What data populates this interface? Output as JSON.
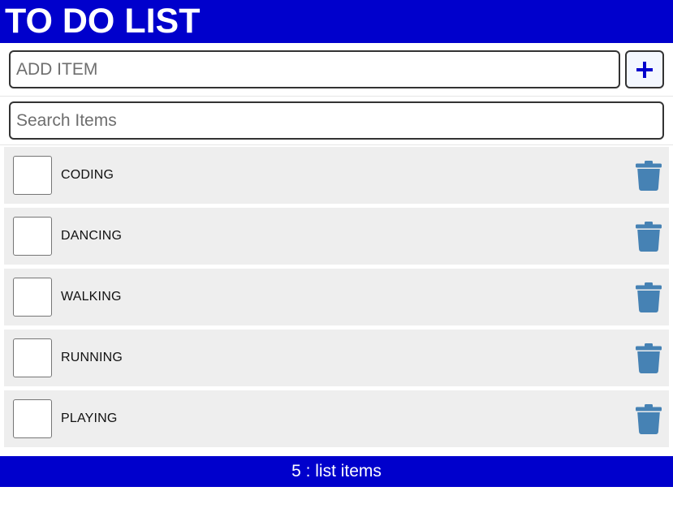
{
  "header": {
    "title": "TO DO LIST"
  },
  "add_item": {
    "placeholder": "ADD ITEM",
    "value": "",
    "button_icon": "plus-icon"
  },
  "search": {
    "placeholder": "Search Items",
    "value": ""
  },
  "items": [
    {
      "label": "CODING",
      "checked": false,
      "delete_icon": "trash-icon"
    },
    {
      "label": "DANCING",
      "checked": false,
      "delete_icon": "trash-icon"
    },
    {
      "label": "WALKING",
      "checked": false,
      "delete_icon": "trash-icon"
    },
    {
      "label": "RUNNING",
      "checked": false,
      "delete_icon": "trash-icon"
    },
    {
      "label": "PLAYING",
      "checked": false,
      "delete_icon": "trash-icon"
    }
  ],
  "footer": {
    "count_text": "5 : list items"
  },
  "colors": {
    "brand_blue": "#0000cc",
    "trash_blue": "#4682b4",
    "item_background": "#eeeeee"
  }
}
